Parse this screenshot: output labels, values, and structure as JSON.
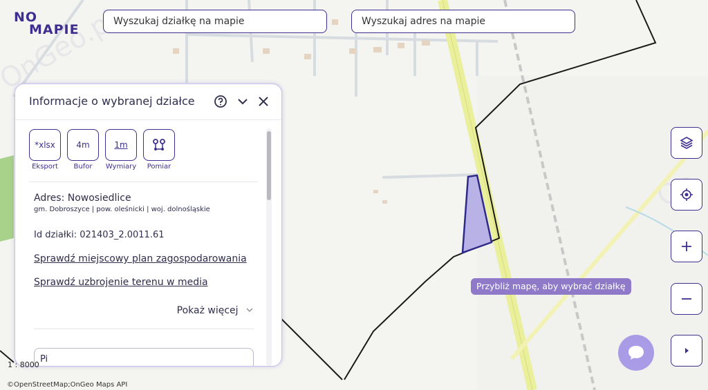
{
  "logo": {
    "line1": "NO",
    "line2": "MAPIE"
  },
  "search": {
    "parcel_placeholder": "Wyszukaj działkę na mapie",
    "address_placeholder": "Wyszukaj adres na mapie"
  },
  "panel": {
    "title": "Informacje o wybranej działce",
    "header_icons": [
      "help-icon",
      "chevron-down-icon",
      "close-icon"
    ],
    "tools": [
      {
        "icon_text": "*xlsx",
        "label": "Eksport"
      },
      {
        "icon_text": "4m",
        "label": "Bufor"
      },
      {
        "icon_text": "1m",
        "label": "Wymiary"
      },
      {
        "icon_text": "",
        "label": "Pomiar",
        "icon": "route-icon"
      }
    ],
    "address_line": "Adres: Nowosiedlice",
    "address_detail": "gm. Dobroszyce | pow. oleśnicki | woj. dolnośląskie",
    "parcel_id": "Id działki: 021403_2.0011.61",
    "link_plan": "Sprawdź miejscowy plan zagospodarowania",
    "link_media": "Sprawdź uzbrojenie terenu w media",
    "show_more": "Pokaż więcej",
    "partial_field": "Pi"
  },
  "map": {
    "scale": "1 : 8000",
    "attribution": "©OpenStreetMap;OnGeo Maps API",
    "tooltip": "Przybliż mapę, aby wybrać działkę",
    "watermark": "OnGeo.pl",
    "buttons": [
      "layers-icon",
      "locate-icon",
      "zoom-in-icon",
      "zoom-out-icon",
      "expand-icon"
    ],
    "parcel_fill": "#b8b2e6",
    "parcel_stroke": "#2f2a8a",
    "road_color": "#e9ef9b"
  },
  "colors": {
    "accent": "#3f2d8f",
    "chat": "#a99be6",
    "tooltip": "#8e7ac8"
  }
}
